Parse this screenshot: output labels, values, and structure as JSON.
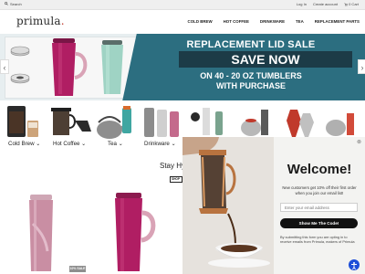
{
  "utility": {
    "search_label": "Search",
    "login_label": "Log In",
    "create_account_label": "Create account",
    "cart_label": "0 Cart"
  },
  "header": {
    "logo_text": "primula",
    "nav": [
      "COLD BREW",
      "HOT COFFEE",
      "DRINKWARE",
      "TEA",
      "REPLACEMENT PARTS"
    ]
  },
  "hero": {
    "title": "REPLACEMENT LID SALE",
    "headline": "SAVE NOW",
    "line1": "ON 40 - 20 OZ TUMBLERS",
    "line2": "WITH PURCHASE",
    "prev_arrow": "‹",
    "next_arrow": "›"
  },
  "categories": [
    {
      "label": "Cold Brew ⌄"
    },
    {
      "label": "Hot Coffee ⌄"
    },
    {
      "label": "Tea ⌄"
    },
    {
      "label": "Drinkware ⌄"
    }
  ],
  "section": {
    "heading": "Stay Hy",
    "shop_label": "SHOP"
  },
  "product_badge": "10% SALE",
  "popup": {
    "close": "⊗",
    "title": "Welcome!",
    "description": "New customers get 10% off their first order when you join our email list!",
    "email_placeholder": "Enter your email address",
    "button_label": "Show Me The Code!",
    "legal": "By submitting this form you are opting in to receive emails from Primula, makers of Primula"
  },
  "colors": {
    "teal": "#2c6e80",
    "dark_teal": "#1c3b47",
    "tumbler_pink": "#b01e63",
    "accessibility_blue": "#1d4ed8"
  }
}
